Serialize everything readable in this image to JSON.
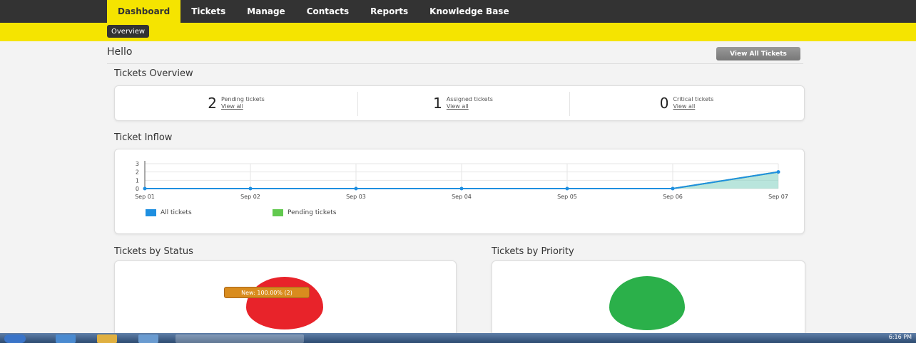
{
  "nav": {
    "items": [
      {
        "label": "Dashboard",
        "active": true
      },
      {
        "label": "Tickets",
        "active": false
      },
      {
        "label": "Manage",
        "active": false
      },
      {
        "label": "Contacts",
        "active": false
      },
      {
        "label": "Reports",
        "active": false
      },
      {
        "label": "Knowledge Base",
        "active": false
      }
    ],
    "sub_item": "Overview"
  },
  "greeting": "Hello",
  "view_all_tickets_label": "View All Tickets",
  "overview": {
    "title": "Tickets Overview",
    "cells": [
      {
        "count": "2",
        "label": "Pending tickets",
        "link": "View all"
      },
      {
        "count": "1",
        "label": "Assigned tickets",
        "link": "View all"
      },
      {
        "count": "0",
        "label": "Critical tickets",
        "link": "View all"
      }
    ]
  },
  "inflow": {
    "title": "Ticket Inflow",
    "legend": [
      {
        "label": "All tickets",
        "color": "#1f8fe0"
      },
      {
        "label": "Pending tickets",
        "color": "#62c94f"
      }
    ]
  },
  "status": {
    "title": "Tickets by Status",
    "tooltip": "New: 100.00% (2)",
    "color": "#e8232a"
  },
  "priority": {
    "title": "Tickets by Priority",
    "color": "#2bb04a"
  },
  "taskbar": {
    "clock": "6:16 PM"
  },
  "chart_data": {
    "type": "line",
    "title": "Ticket Inflow",
    "categories": [
      "Sep 01",
      "Sep 02",
      "Sep 03",
      "Sep 04",
      "Sep 05",
      "Sep 06",
      "Sep 07"
    ],
    "series": [
      {
        "name": "All tickets",
        "values": [
          0,
          0,
          0,
          0,
          0,
          0,
          2
        ]
      },
      {
        "name": "Pending tickets",
        "values": [
          0,
          0,
          0,
          0,
          0,
          0,
          2
        ]
      }
    ],
    "yticks": [
      "0",
      "1",
      "2",
      "3"
    ],
    "ylim": [
      0,
      3
    ],
    "legend": "bottom-left",
    "grid": true
  }
}
